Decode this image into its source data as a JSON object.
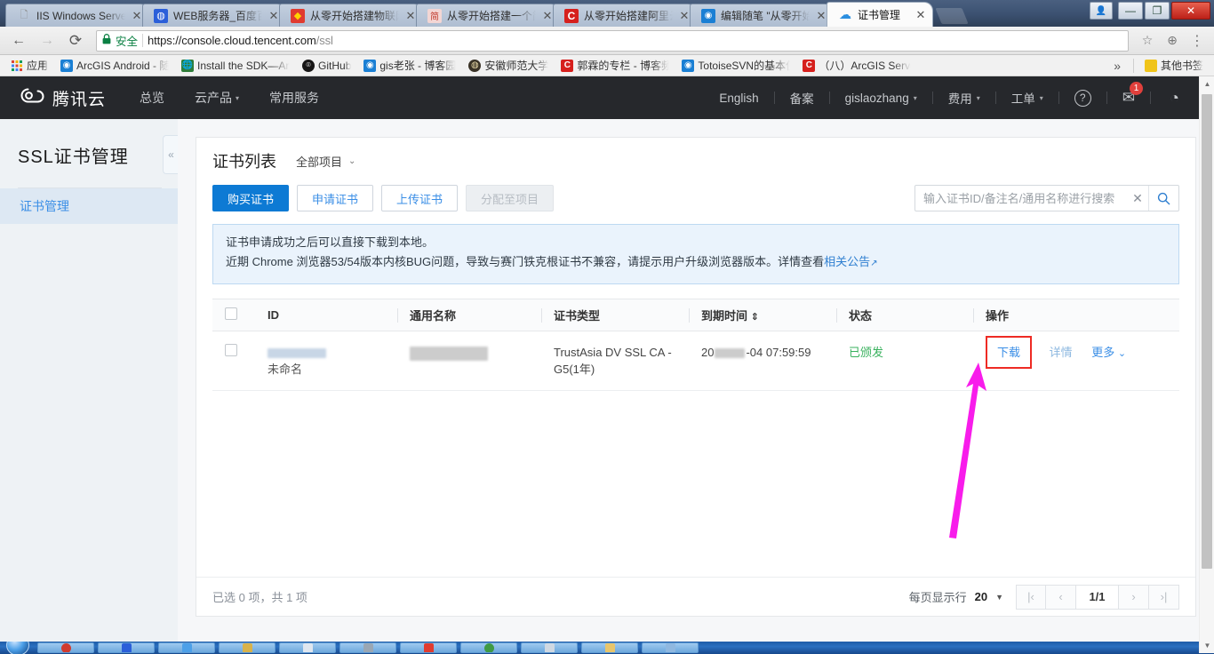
{
  "browser": {
    "tabs": [
      {
        "title": "IIS Windows Serve",
        "favicon": "page-icon",
        "active": false
      },
      {
        "title": "WEB服务器_百度百",
        "favicon": "baidu-icon",
        "active": false
      },
      {
        "title": "从零开始搭建物联网",
        "favicon": "csdn-icon",
        "active": false
      },
      {
        "title": "从零开始搭建一个简",
        "favicon": "jianshu-icon",
        "active": false
      },
      {
        "title": "从零开始搭建阿里云",
        "favicon": "csdn-icon",
        "active": false
      },
      {
        "title": "编辑随笔 \"从零开始",
        "favicon": "cnblogs-icon",
        "active": false
      },
      {
        "title": "证书管理",
        "favicon": "tencent-cloud-icon",
        "active": true
      }
    ],
    "close_glyph": "✕",
    "window_controls": {
      "user": "👤",
      "minimize": "—",
      "maximize": "❐",
      "close": "✕"
    },
    "nav": {
      "back": "←",
      "forward": "→",
      "reload": "⟳"
    },
    "omnibox": {
      "lock_glyph": "🔒",
      "secure_label": "安全",
      "url_protocol": "https://",
      "url_host": "console.cloud.tencent.com",
      "url_path": "/ssl"
    },
    "toolbar_icons": {
      "star": "☆",
      "extension": "⊕",
      "menu": "⋮"
    },
    "bookmarks": [
      {
        "label": "应用",
        "icon": "apps-grid-icon"
      },
      {
        "label": "ArcGIS Android - 随",
        "icon": "cnblogs-icon"
      },
      {
        "label": "Install the SDK—Arc",
        "icon": "globe-icon"
      },
      {
        "label": "GitHub",
        "icon": "github-icon"
      },
      {
        "label": "gis老张 - 博客园",
        "icon": "cnblogs-icon"
      },
      {
        "label": "安徽师范大学",
        "icon": "university-icon"
      },
      {
        "label": "郭霖的专栏 - 博客频",
        "icon": "csdn-icon"
      },
      {
        "label": "TotoiseSVN的基本使",
        "icon": "cnblogs-icon"
      },
      {
        "label": "（八）ArcGIS Server",
        "icon": "csdn-icon"
      }
    ],
    "bookmarks_overflow": "»",
    "other_bookmarks": {
      "label": "其他书签",
      "icon": "folder-icon"
    }
  },
  "qcloud_header": {
    "logo_text": "腾讯云",
    "nav": [
      {
        "label": "总览",
        "caret": false
      },
      {
        "label": "云产品",
        "caret": true
      },
      {
        "label": "常用服务",
        "caret": false
      }
    ],
    "right": [
      {
        "label": "English",
        "caret": false
      },
      {
        "label": "备案",
        "caret": false
      },
      {
        "label": "gislaozhang",
        "caret": true
      },
      {
        "label": "费用",
        "caret": true
      },
      {
        "label": "工单",
        "caret": true
      }
    ],
    "help_glyph": "?",
    "mail_glyph": "✉",
    "mail_badge": "1",
    "clock_glyph": "◷",
    "caret_glyph": "▾"
  },
  "sidebar": {
    "title": "SSL证书管理",
    "items": [
      {
        "label": "证书管理",
        "active": true
      }
    ],
    "collapse_glyph": "«"
  },
  "main": {
    "panel_title": "证书列表",
    "project_select": {
      "label": "全部项目",
      "chevron": "⌄"
    },
    "buttons": [
      {
        "label": "购买证书",
        "style": "primary"
      },
      {
        "label": "申请证书",
        "style": "default"
      },
      {
        "label": "上传证书",
        "style": "default"
      },
      {
        "label": "分配至项目",
        "style": "disabled"
      }
    ],
    "search": {
      "placeholder": "输入证书ID/备注名/通用名称进行搜索",
      "value": "",
      "clear_glyph": "✕",
      "search_glyph": "⚲"
    },
    "notice": {
      "line1": "证书申请成功之后可以直接下载到本地。",
      "line2_pre": "近期 Chrome 浏览器53/54版本内核BUG问题，导致与赛门铁克根证书不兼容，请提示用户升级浏览器版本。详情查看",
      "line2_link": "相关公告",
      "external_glyph": "↗"
    },
    "table": {
      "columns": [
        "ID",
        "通用名称",
        "证书类型",
        "到期时间",
        "状态",
        "操作"
      ],
      "sort_glyph": "⇕",
      "rows": [
        {
          "id_redacted": true,
          "id_note": "未命名",
          "common_name_redacted": true,
          "cert_type": "TrustAsia DV SSL CA - G5(1年)",
          "expire_prefix": "20",
          "expire_suffix": "-04 07:59:59",
          "status": "已颁发",
          "actions": [
            {
              "label": "下载",
              "highlighted": true
            },
            {
              "label": "详情",
              "highlighted": false
            },
            {
              "label": "更多",
              "highlighted": false,
              "chevron": "⌄"
            }
          ]
        }
      ]
    },
    "footer": {
      "selection_text": "已选 0 项，共 1 项",
      "per_page_label": "每页显示行",
      "per_page_value": "20",
      "per_page_chevron": "▼",
      "pager": {
        "first": "|‹",
        "prev": "‹",
        "current": "1/1",
        "next": "›",
        "last": "›|"
      }
    }
  },
  "scrollbar": {
    "up_glyph": "▲",
    "down_glyph": "▼"
  },
  "annotation": {
    "arrow_color": "#f81ceb"
  }
}
